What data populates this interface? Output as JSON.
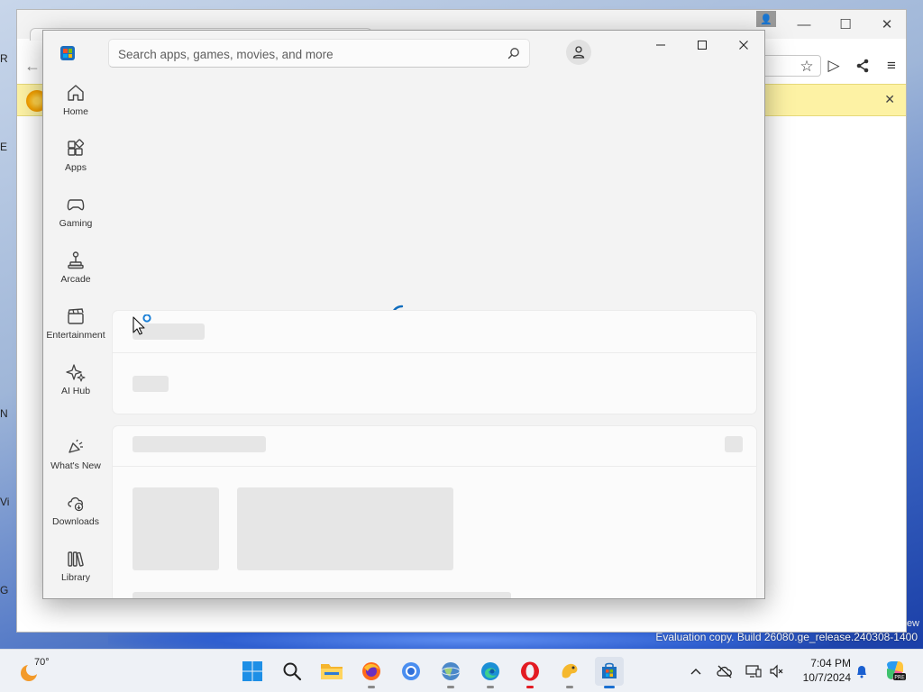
{
  "desktop": {
    "edge_letters": [
      "R",
      "E",
      "N",
      "Vi",
      "G"
    ],
    "watermark": "Evaluation copy. Build 26080.ge_release.240308-1400",
    "watermark_tail": "ew"
  },
  "browser": {
    "minimize_glyph": "—",
    "maximize_glyph": "☐",
    "close_glyph": "✕",
    "back_glyph": "←",
    "star_glyph": "☆",
    "play_glyph": "▷",
    "share_glyph": "⋖",
    "menu_glyph": "≡",
    "infobar_close": "✕",
    "profile_glyph": "👤"
  },
  "store": {
    "search": {
      "placeholder": "Search apps, games, movies, and more"
    },
    "window_controls": {
      "minimize": "—",
      "maximize": "☐",
      "close": "✕"
    },
    "nav": [
      {
        "id": "home",
        "label": "Home",
        "icon": "home-icon"
      },
      {
        "id": "apps",
        "label": "Apps",
        "icon": "apps-icon"
      },
      {
        "id": "gaming",
        "label": "Gaming",
        "icon": "gamepad-icon"
      },
      {
        "id": "arcade",
        "label": "Arcade",
        "icon": "joystick-icon"
      },
      {
        "id": "entertainment",
        "label": "Entertainment",
        "icon": "clapperboard-icon"
      },
      {
        "id": "ai-hub",
        "label": "AI Hub",
        "icon": "sparkle-icon"
      },
      {
        "id": "whats-new",
        "label": "What's New",
        "icon": "megaphone-icon"
      },
      {
        "id": "downloads",
        "label": "Downloads",
        "icon": "cloud-download-icon"
      },
      {
        "id": "library",
        "label": "Library",
        "icon": "library-icon"
      }
    ],
    "state": "loading"
  },
  "taskbar": {
    "weather_temp": "70°",
    "time": "7:04 PM",
    "date": "10/7/2024",
    "apps": [
      "start",
      "search",
      "file-explorer",
      "firefox",
      "chrome",
      "globe-browser",
      "edge",
      "opera",
      "pidgin",
      "microsoft-store"
    ],
    "active_app": "microsoft-store",
    "tray_chevron": "^"
  },
  "colors": {
    "accent": "#0f6cbd",
    "store_bg": "#f3f3f3",
    "skeleton": "#e6e6e6",
    "infobar": "#fdf2a4"
  }
}
